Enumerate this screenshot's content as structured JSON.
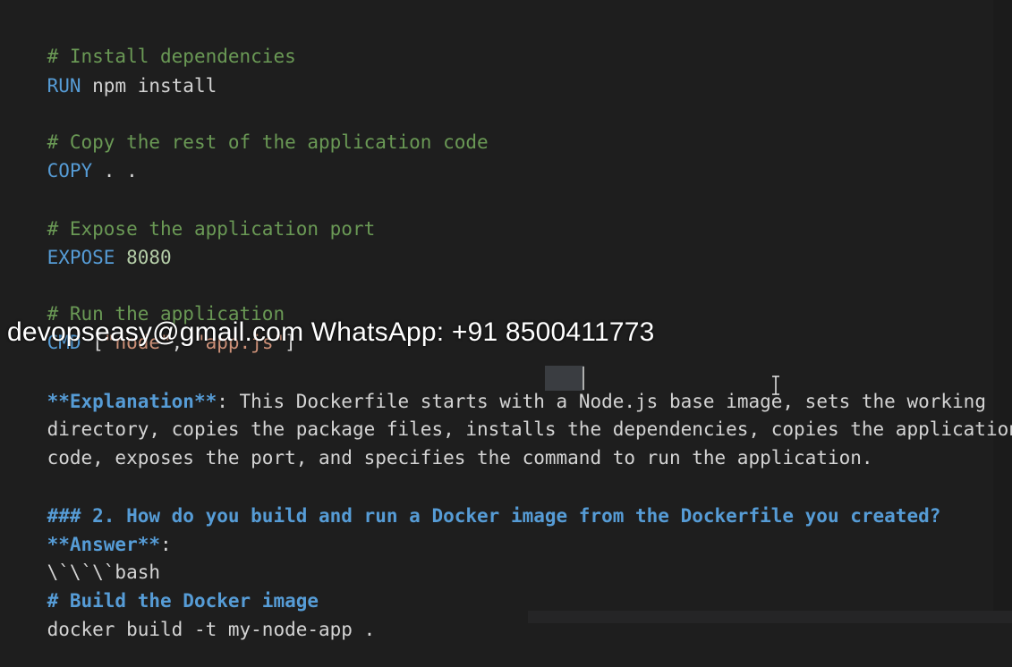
{
  "editor": {
    "lines": {
      "l1_comment": "# Install dependencies",
      "l2_kw": "RUN",
      "l2_rest": " npm install",
      "l4_comment": "# Copy the rest of the application code",
      "l5_kw": "COPY",
      "l5_rest": " . .",
      "l7_comment": "# Expose the application port",
      "l8_kw": "EXPOSE",
      "l8_num": " 8080",
      "l10_comment": "# Run the application",
      "l11_kw": "CMD",
      "l11_open": " [",
      "l11_s1": "\"node\"",
      "l11_sep": ", ",
      "l11_s2": "\"app.js\"",
      "l11_close": "]",
      "l12_bold": "**Explanation**",
      "l12_rest": ": This Dockerfile starts with a Node.js base image, sets the working",
      "l13": "directory, copies the package files, installs the dependencies, copies the application",
      "l14": "code, exposes the port, and specifies the command to run the application.",
      "l16_heading": "### 2. How do you build and run a Docker image from the Dockerfile you created?",
      "l17_bold": "**Answer**",
      "l17_rest": ":",
      "l18": "\\`\\`\\`bash",
      "l19_heading": "# Build the Docker image",
      "l20": "docker build -t my-node-app ."
    }
  },
  "watermark": {
    "text": "devopseasy@gmail.com WhatsApp: +91 8500411773"
  },
  "colors": {
    "background": "#1e1e1e",
    "comment": "#6a9955",
    "keyword": "#569cd6",
    "string": "#ce9178",
    "number": "#b5cea8",
    "text": "#d4d4d4"
  }
}
